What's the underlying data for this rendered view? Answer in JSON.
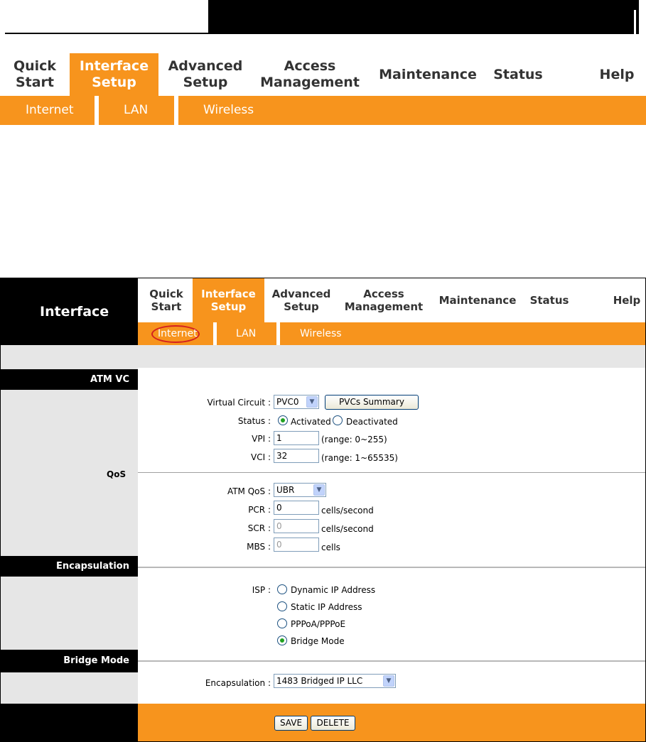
{
  "top_nav": {
    "items": [
      {
        "line1": "Quick",
        "line2": "Start",
        "active": false
      },
      {
        "line1": "Interface",
        "line2": "Setup",
        "active": true
      },
      {
        "line1": "Advanced",
        "line2": "Setup",
        "active": false
      },
      {
        "line1": "Access",
        "line2": "Management",
        "active": false
      },
      {
        "line1": "Maintenance",
        "line2": "",
        "active": false
      },
      {
        "line1": "Status",
        "line2": "",
        "active": false
      },
      {
        "line1": "Help",
        "line2": "",
        "active": false
      }
    ],
    "subitems": [
      "Internet",
      "LAN",
      "Wireless"
    ]
  },
  "main": {
    "brand": "Interface",
    "nav": {
      "items": [
        {
          "line1": "Quick",
          "line2": "Start"
        },
        {
          "line1": "Interface",
          "line2": "Setup"
        },
        {
          "line1": "Advanced",
          "line2": "Setup"
        },
        {
          "line1": "Access",
          "line2": "Management"
        },
        {
          "line1": "Maintenance",
          "line2": ""
        },
        {
          "line1": "Status",
          "line2": ""
        },
        {
          "line1": "Help",
          "line2": ""
        }
      ],
      "subitems": [
        "Internet",
        "LAN",
        "Wireless"
      ]
    },
    "sections": {
      "atm_vc": "ATM VC",
      "qos": "QoS",
      "encapsulation": "Encapsulation",
      "bridge_mode": "Bridge Mode"
    },
    "atm": {
      "virtual_circuit_label": "Virtual Circuit :",
      "virtual_circuit_value": "PVC0",
      "pvcs_summary_button": "PVCs Summary",
      "status_label": "Status :",
      "status_activated": "Activated",
      "status_deactivated": "Deactivated",
      "vpi_label": "VPI :",
      "vpi_value": "1",
      "vpi_range": "(range: 0~255)",
      "vci_label": "VCI :",
      "vci_value": "32",
      "vci_range": "(range: 1~65535)"
    },
    "qos": {
      "atm_qos_label": "ATM QoS :",
      "atm_qos_value": "UBR",
      "pcr_label": "PCR :",
      "pcr_value": "0",
      "pcr_unit": "cells/second",
      "scr_label": "SCR :",
      "scr_value": "0",
      "scr_unit": "cells/second",
      "mbs_label": "MBS :",
      "mbs_value": "0",
      "mbs_unit": "cells"
    },
    "isp": {
      "label": "ISP :",
      "options": [
        "Dynamic IP Address",
        "Static IP Address",
        "PPPoA/PPPoE",
        "Bridge Mode"
      ],
      "selected": "Bridge Mode"
    },
    "bridge": {
      "encapsulation_label": "Encapsulation :",
      "encapsulation_value": "1483 Bridged IP LLC"
    },
    "footer": {
      "save": "SAVE",
      "delete": "DELETE"
    }
  },
  "colors": {
    "accent": "#f7941d",
    "black": "#000000",
    "gray": "#e6e6e6",
    "highlight_oval": "#d32020"
  }
}
